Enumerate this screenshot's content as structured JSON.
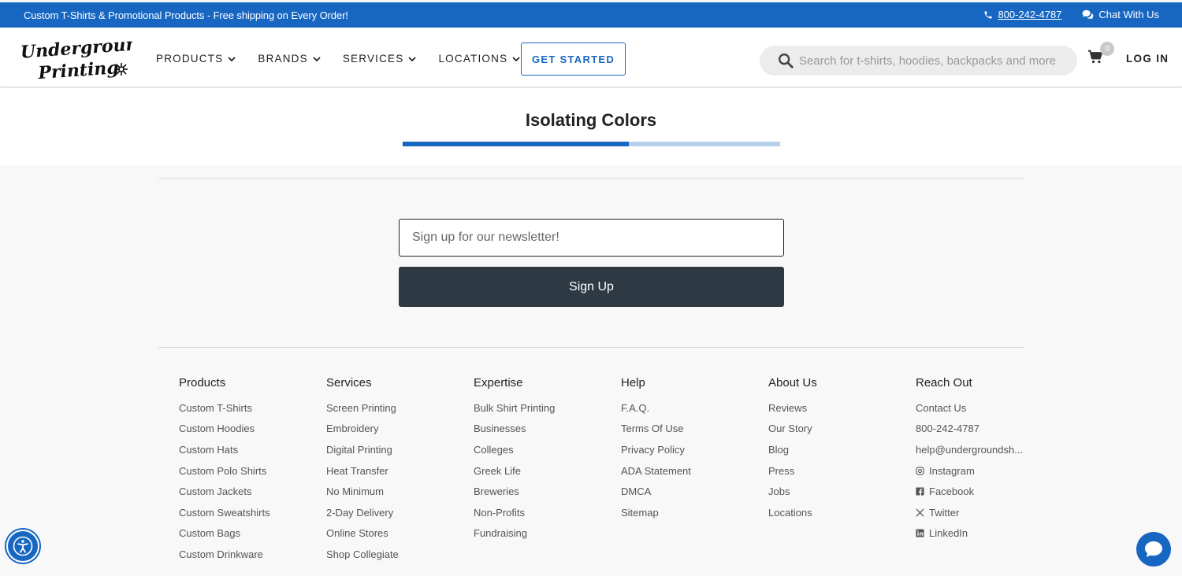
{
  "topbar": {
    "promo": "Custom T-Shirts & Promotional Products - Free shipping on Every Order!",
    "phone": "800-242-4787",
    "chat": "Chat With Us"
  },
  "header": {
    "logo_line1": "Underground",
    "logo_line2": "Printing",
    "nav": [
      "PRODUCTS",
      "BRANDS",
      "SERVICES",
      "LOCATIONS"
    ],
    "cta": "GET STARTED",
    "search_placeholder": "Search for t-shirts, hoodies, backpacks and more",
    "cart_count": "0",
    "login": "LOG IN"
  },
  "section": {
    "title": "Isolating Colors",
    "progress_fraction": 0.6
  },
  "newsletter": {
    "placeholder": "Sign up for our newsletter!",
    "button": "Sign Up"
  },
  "footer": {
    "columns": [
      {
        "heading": "Products",
        "links": [
          "Custom T-Shirts",
          "Custom Hoodies",
          "Custom Hats",
          "Custom Polo Shirts",
          "Custom Jackets",
          "Custom Sweatshirts",
          "Custom Bags",
          "Custom Drinkware"
        ]
      },
      {
        "heading": "Services",
        "links": [
          "Screen Printing",
          "Embroidery",
          "Digital Printing",
          "Heat Transfer",
          "No Minimum",
          "2-Day Delivery",
          "Online Stores",
          "Shop Collegiate"
        ]
      },
      {
        "heading": "Expertise",
        "links": [
          "Bulk Shirt Printing",
          "Businesses",
          "Colleges",
          "Greek Life",
          "Breweries",
          "Non-Profits",
          "Fundraising"
        ]
      },
      {
        "heading": "Help",
        "links": [
          "F.A.Q.",
          "Terms Of Use",
          "Privacy Policy",
          "ADA Statement",
          "DMCA",
          "Sitemap"
        ]
      },
      {
        "heading": "About Us",
        "links": [
          "Reviews",
          "Our Story",
          "Blog",
          "Press",
          "Jobs",
          "Locations"
        ]
      },
      {
        "heading": "Reach Out",
        "links": [
          "Contact Us",
          "800-242-4787",
          "help@undergroundsh...",
          "Instagram",
          "Facebook",
          "Twitter",
          "LinkedIn"
        ]
      }
    ]
  },
  "colors": {
    "brand_blue": "#1767c2",
    "button_dark": "#2d3943"
  }
}
